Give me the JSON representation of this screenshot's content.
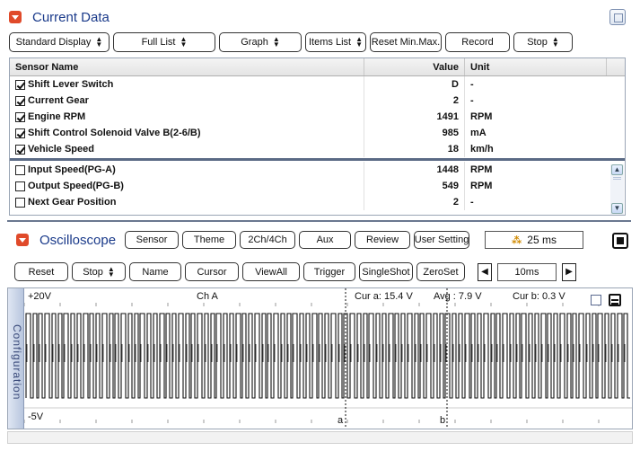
{
  "current_data": {
    "title": "Current Data",
    "toolbar": [
      {
        "label": "Standard Display",
        "spinner": true,
        "w": 0
      },
      {
        "label": "Full List",
        "spinner": true
      },
      {
        "label": "Graph",
        "spinner": true
      },
      {
        "label": "Items List",
        "spinner": true
      },
      {
        "label": "Reset Min.Max.",
        "spinner": false
      },
      {
        "label": "Record",
        "spinner": false
      },
      {
        "label": "Stop",
        "spinner": true
      }
    ],
    "columns": {
      "name": "Sensor Name",
      "value": "Value",
      "unit": "Unit"
    },
    "rows_selected": [
      {
        "checked": true,
        "name": "Shift Lever Switch",
        "value": "D",
        "unit": "-"
      },
      {
        "checked": true,
        "name": "Current Gear",
        "value": "2",
        "unit": "-"
      },
      {
        "checked": true,
        "name": "Engine RPM",
        "value": "1491",
        "unit": "RPM"
      },
      {
        "checked": true,
        "name": "Shift Control Solenoid Valve B(2-6/B)",
        "value": "985",
        "unit": "mA"
      },
      {
        "checked": true,
        "name": "Vehicle Speed",
        "value": "18",
        "unit": "km/h"
      }
    ],
    "rows_other": [
      {
        "checked": false,
        "name": "Input Speed(PG-A)",
        "value": "1448",
        "unit": "RPM"
      },
      {
        "checked": false,
        "name": "Output Speed(PG-B)",
        "value": "549",
        "unit": "RPM"
      },
      {
        "checked": false,
        "name": "Next Gear Position",
        "value": "2",
        "unit": "-"
      }
    ]
  },
  "oscilloscope": {
    "title": "Oscilloscope",
    "tabs": [
      "Sensor",
      "Theme",
      "2Ch/4Ch",
      "Aux",
      "Review",
      "User Setting"
    ],
    "interval_display": "25 ms",
    "toolbar": [
      {
        "label": "Reset",
        "spinner": false
      },
      {
        "label": "Stop",
        "spinner": true
      },
      {
        "label": "Name",
        "spinner": false
      },
      {
        "label": "Cursor",
        "spinner": false
      },
      {
        "label": "ViewAll",
        "spinner": false
      },
      {
        "label": "Trigger",
        "spinner": false
      },
      {
        "label": "SingleShot",
        "spinner": false
      },
      {
        "label": "ZeroSet",
        "spinner": false
      }
    ],
    "timebase": "10ms",
    "side_tab": "Configuration",
    "plot": {
      "channel": "Ch A",
      "top_label": "+20V",
      "bottom_label": "-5V",
      "cursor_a_text": "Cur a: 15.4 V",
      "avg_text": "Avg : 7.9 V",
      "cursor_b_text": "Cur b: 0.3 V",
      "cursor_a_marker": "a",
      "cursor_b_marker": "b"
    }
  }
}
